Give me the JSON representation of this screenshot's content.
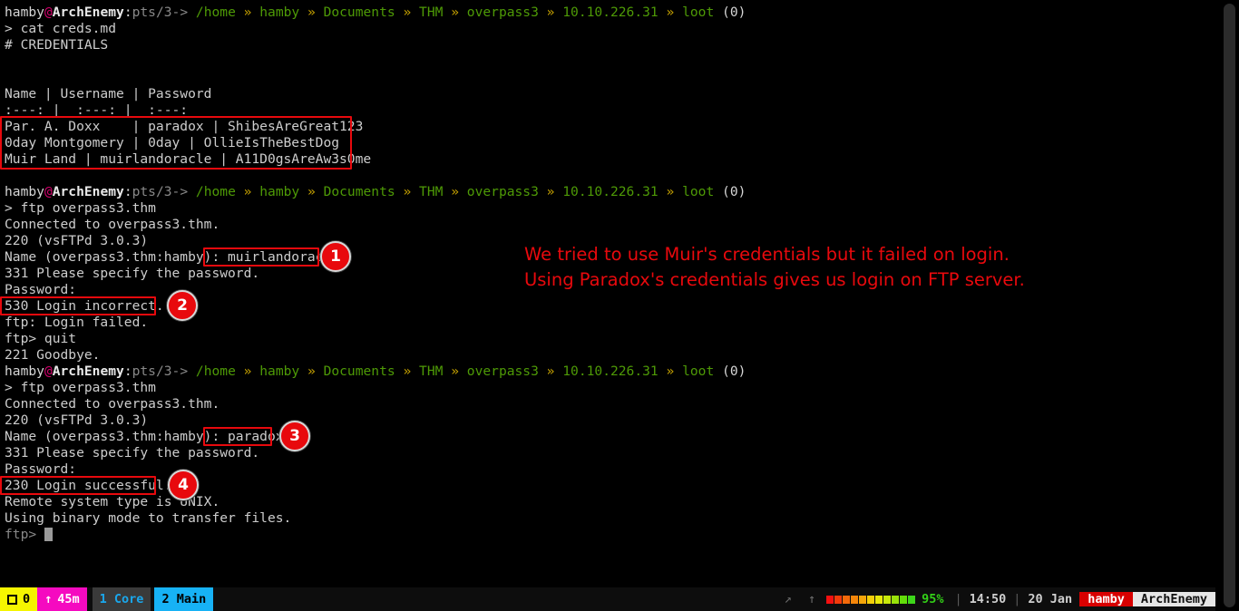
{
  "terminal": {
    "prompt": {
      "user": "hamby",
      "at": "@",
      "host": "ArchEnemy",
      "colon": ":",
      "tty": "pts/3->",
      "sep": "»",
      "path_segments": [
        "/home",
        "hamby",
        "Documents",
        "THM",
        "overpass3",
        "10.10.226.31",
        "loot"
      ],
      "jobs": "(0)"
    },
    "lines": [
      {
        "id": "l01",
        "text": "> cat creds.md"
      },
      {
        "id": "l02",
        "text": "# CREDENTIALS"
      },
      {
        "id": "l03",
        "text": ""
      },
      {
        "id": "l04",
        "text": ""
      },
      {
        "id": "l05",
        "text": "Name | Username | Password"
      },
      {
        "id": "l06",
        "text": ":---: |  :---: |  :---:"
      },
      {
        "id": "l07",
        "text": "Par. A. Doxx    | paradox | ShibesAreGreat123"
      },
      {
        "id": "l08",
        "text": "0day Montgomery | 0day | OllieIsTheBestDog"
      },
      {
        "id": "l09",
        "text": "Muir Land | muirlandoracle | A11D0gsAreAw3s0me"
      },
      {
        "id": "l10",
        "text": ""
      },
      {
        "id": "l11",
        "text": "> ftp overpass3.thm"
      },
      {
        "id": "l12",
        "text": "Connected to overpass3.thm."
      },
      {
        "id": "l13",
        "text": "220 (vsFTPd 3.0.3)"
      },
      {
        "id": "l14",
        "text": "Name (overpass3.thm:hamby): muirlandoracle"
      },
      {
        "id": "l15",
        "text": "331 Please specify the password."
      },
      {
        "id": "l16",
        "text": "Password:"
      },
      {
        "id": "l17",
        "text": "530 Login incorrect."
      },
      {
        "id": "l18",
        "text": "ftp: Login failed."
      },
      {
        "id": "l19",
        "text": "ftp> quit"
      },
      {
        "id": "l20",
        "text": "221 Goodbye."
      },
      {
        "id": "l21",
        "text": "> ftp overpass3.thm"
      },
      {
        "id": "l22",
        "text": "Connected to overpass3.thm."
      },
      {
        "id": "l23",
        "text": "220 (vsFTPd 3.0.3)"
      },
      {
        "id": "l24",
        "text": "Name (overpass3.thm:hamby): paradox"
      },
      {
        "id": "l25",
        "text": "331 Please specify the password."
      },
      {
        "id": "l26",
        "text": "Password:"
      },
      {
        "id": "l27",
        "text": "230 Login successful."
      },
      {
        "id": "l28",
        "text": "Remote system type is UNIX."
      },
      {
        "id": "l29",
        "text": "Using binary mode to transfer files."
      },
      {
        "id": "l30",
        "text": "ftp> "
      }
    ],
    "credentials_table": {
      "header": "Name | Username | Password",
      "divider": ":---: |  :---: |  :---:",
      "rows": [
        {
          "name": "Par. A. Doxx",
          "username": "paradox",
          "password": "ShibesAreGreat123"
        },
        {
          "name": "0day Montgomery",
          "username": "0day",
          "password": "OllieIsTheBestDog"
        },
        {
          "name": "Muir Land",
          "username": "muirlandoracle",
          "password": "A11D0gsAreAw3s0me"
        }
      ]
    }
  },
  "annotations": {
    "note_line_1": "We tried to use Muir's credentials but it failed on login.",
    "note_line_2": "Using Paradox's credentials gives us login on FTP server.",
    "badges": [
      {
        "number": "1",
        "target": "muirlandoracle"
      },
      {
        "number": "2",
        "target": "530 Login incorrect."
      },
      {
        "number": "3",
        "target": "paradox"
      },
      {
        "number": "4",
        "target": "230 Login successful."
      }
    ],
    "accent_color": "#e8090d"
  },
  "statusbar": {
    "windows_icon": "window-icon",
    "windows_count": "0",
    "uptime_icon": "↑",
    "uptime": "45m",
    "workspaces": [
      {
        "label": "1 Core",
        "active": false
      },
      {
        "label": "2 Main",
        "active": true
      }
    ],
    "network_icons": "↗ ↑",
    "battery_percent": "95%",
    "battery_blocks": 11,
    "battery_colors": [
      "#f41010",
      "#f43a0a",
      "#f4690a",
      "#f4860a",
      "#f4a60a",
      "#f4cf0a",
      "#e8e80a",
      "#c8e80a",
      "#9ae30a",
      "#63dd0a",
      "#3dd61a"
    ],
    "separator": "|",
    "time": "14:50",
    "date": "20 Jan",
    "user": "hamby",
    "host": "ArchEnemy"
  }
}
